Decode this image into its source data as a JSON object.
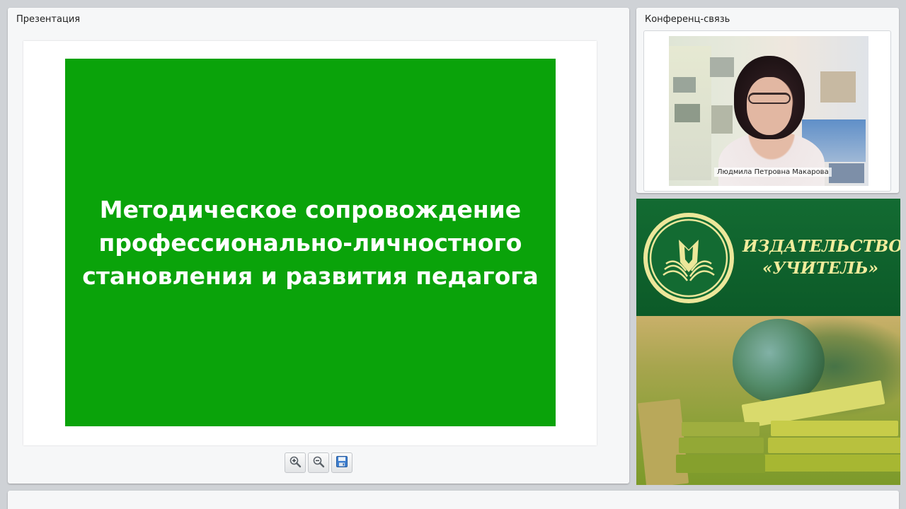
{
  "presentation": {
    "title": "Презентация",
    "slide": {
      "title": "Методическое сопровождение\nпрофессионально-личностного\nстановления и развития педагога",
      "background_color": "#0aa30a"
    },
    "toolbar": {
      "zoom_in_icon": "zoom-in-icon",
      "zoom_out_icon": "zoom-out-icon",
      "save_icon": "floppy-disk-icon"
    }
  },
  "conference": {
    "title": "Конференц-связь",
    "speaker_name": "Людмила Петровна Макарова"
  },
  "publisher_banner": {
    "name": "ИЗДАТЕЛЬСТВО\n«УЧИТЕЛЬ»",
    "colors": {
      "dark_green": "#136b32",
      "gold": "#f2ec9c"
    }
  }
}
